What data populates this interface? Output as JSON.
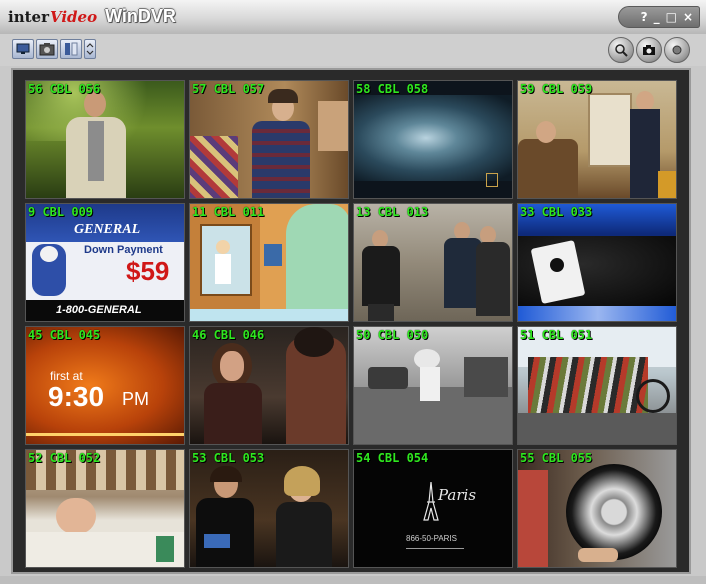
{
  "window": {
    "brand_inter": "inter",
    "brand_video": "Video",
    "app_name": "WinDVR",
    "controls": [
      "?",
      "_",
      "□",
      "×"
    ]
  },
  "toolbar": {
    "left_buttons": [
      "monitor-icon",
      "camera-icon",
      "panel-icon",
      "arrow-icon"
    ],
    "right_buttons": [
      "zoom-icon",
      "snapshot-icon",
      "record-icon"
    ]
  },
  "channels": [
    {
      "label": "56 CBL 056"
    },
    {
      "label": "57 CBL 057"
    },
    {
      "label": "58 CBL 058"
    },
    {
      "label": "59 CBL 059"
    },
    {
      "label": "9 CBL 009"
    },
    {
      "label": "11 CBL 011"
    },
    {
      "label": "13 CBL 013"
    },
    {
      "label": "33 CBL 033"
    },
    {
      "label": "45 CBL 045"
    },
    {
      "label": "46 CBL 046"
    },
    {
      "label": "50 CBL 050"
    },
    {
      "label": "51 CBL 051"
    },
    {
      "label": "52 CBL 052"
    },
    {
      "label": "53 CBL 053"
    },
    {
      "label": "54 CBL 054"
    },
    {
      "label": "55 CBL 055"
    }
  ],
  "tile_text": {
    "general_brand": "GENERAL",
    "down_payment": "Down Payment",
    "price": "$59",
    "phone": "1-800-GENERAL",
    "first_at": "first at",
    "time": "9:30",
    "pm": "PM",
    "paris_logo": "Paris",
    "paris_phone": "866-50-PARIS"
  },
  "colors": {
    "channel_label": "#2fe81f",
    "frame": "#2a2a2a",
    "window_bg": "#c9c9c9"
  }
}
